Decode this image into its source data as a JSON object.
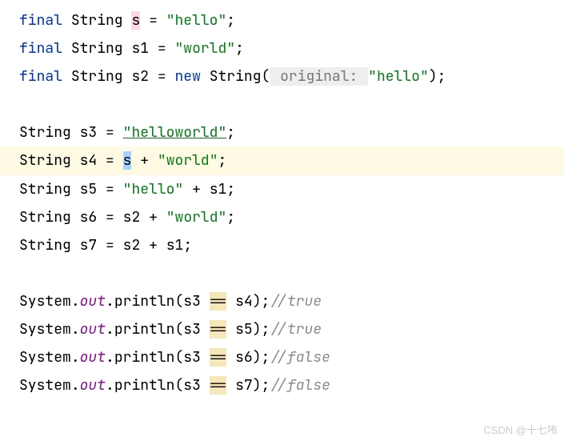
{
  "lines": {
    "l1": {
      "kw": "final",
      "type": "String",
      "var": "s",
      "eq": "=",
      "str": "\"hello\"",
      "semi": ";"
    },
    "l2": {
      "kw": "final",
      "type": "String",
      "var": "s1",
      "eq": "=",
      "str": "\"world\"",
      "semi": ";"
    },
    "l3": {
      "kw": "final",
      "type": "String",
      "var": "s2",
      "eq": "=",
      "new_kw": "new",
      "ctor": "String",
      "lparen": "(",
      "hint": " original: ",
      "str": "\"hello\"",
      "rparen": ")",
      "semi": ";"
    },
    "l4": {
      "type": "String",
      "var": "s3",
      "eq": "=",
      "str": "\"helloworld\"",
      "semi": ";"
    },
    "l5": {
      "type": "String",
      "var": "s4",
      "eq": "=",
      "ref": "s",
      "plus": "+",
      "str": "\"world\"",
      "semi": ";"
    },
    "l6": {
      "type": "String",
      "var": "s5",
      "eq": "=",
      "str": "\"hello\"",
      "plus": "+",
      "ref": "s1",
      "semi": ";"
    },
    "l7": {
      "type": "String",
      "var": "s6",
      "eq": "=",
      "ref": "s2",
      "plus": "+",
      "str": "\"world\"",
      "semi": ";"
    },
    "l8": {
      "type": "String",
      "var": "s7",
      "eq": "=",
      "ref1": "s2",
      "plus": "+",
      "ref2": "s1",
      "semi": ";"
    },
    "p1": {
      "cls": "System",
      "dot1": ".",
      "out": "out",
      "dot2": ".",
      "method": "println",
      "lparen": "(",
      "arg1": "s3",
      "op": "==",
      "arg2": "s4",
      "rparen": ")",
      "semi": ";",
      "comment": "//true"
    },
    "p2": {
      "cls": "System",
      "dot1": ".",
      "out": "out",
      "dot2": ".",
      "method": "println",
      "lparen": "(",
      "arg1": "s3",
      "op": "==",
      "arg2": "s5",
      "rparen": ")",
      "semi": ";",
      "comment": "//true"
    },
    "p3": {
      "cls": "System",
      "dot1": ".",
      "out": "out",
      "dot2": ".",
      "method": "println",
      "lparen": "(",
      "arg1": "s3",
      "op": "==",
      "arg2": "s6",
      "rparen": ")",
      "semi": ";",
      "comment": "//false"
    },
    "p4": {
      "cls": "System",
      "dot1": ".",
      "out": "out",
      "dot2": ".",
      "method": "println",
      "lparen": "(",
      "arg1": "s3",
      "op": "==",
      "arg2": "s7",
      "rparen": ")",
      "semi": ";",
      "comment": "//false"
    }
  },
  "watermark": "CSDN @十七咘"
}
